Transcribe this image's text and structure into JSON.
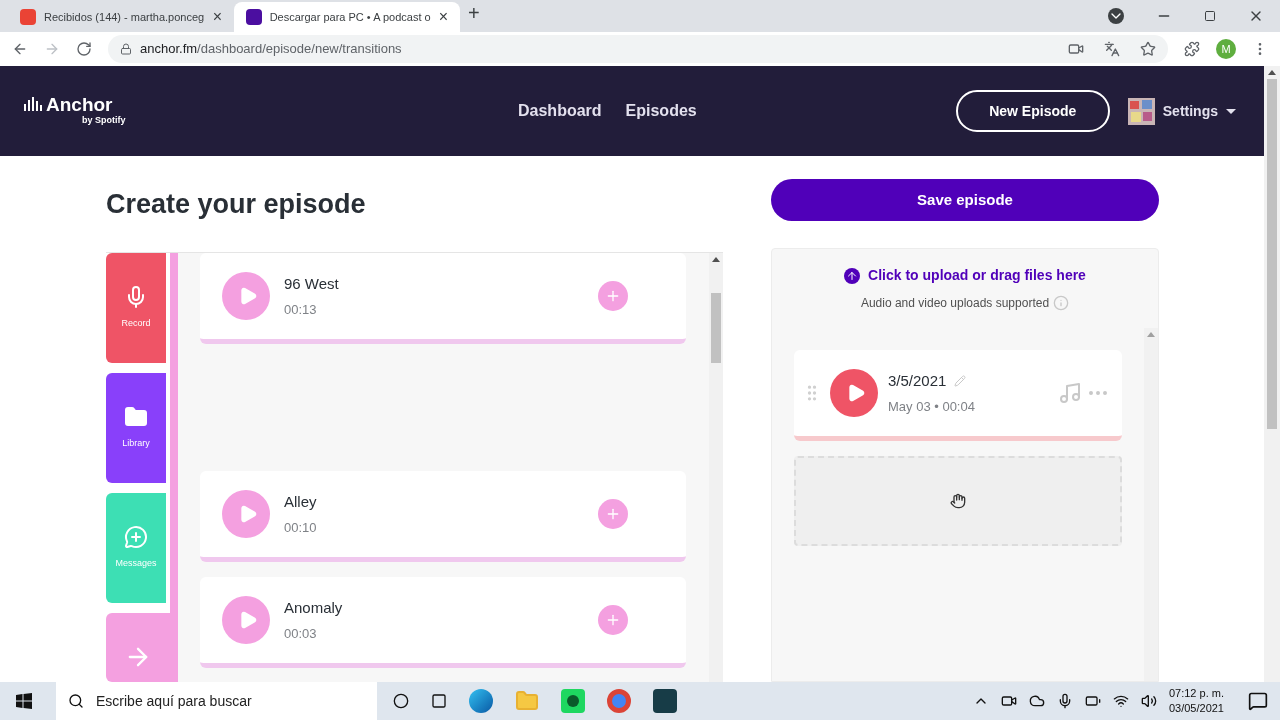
{
  "browser": {
    "tabs": [
      {
        "title": "Recibidos (144) - martha.ponceg",
        "selected": false,
        "close": "×"
      },
      {
        "title": "Descargar para PC • A podcast o",
        "selected": true,
        "close": "×"
      }
    ],
    "new_tab": "+",
    "url_host": "anchor.fm",
    "url_path": "/dashboard/episode/new/transitions",
    "profile": "M"
  },
  "header": {
    "logo": "Anchor",
    "logo_sub": "by Spotify",
    "nav": [
      {
        "label": "Dashboard"
      },
      {
        "label": "Episodes"
      }
    ],
    "new_episode": "New Episode",
    "settings": "Settings"
  },
  "page": {
    "title": "Create your episode",
    "save": "Save episode"
  },
  "tools": [
    {
      "kind": "record",
      "label": "Record",
      "color": "#ef5466",
      "selected": false
    },
    {
      "kind": "library",
      "label": "Library",
      "color": "#8940fa",
      "selected": false
    },
    {
      "kind": "messages",
      "label": "Messages",
      "color": "#3ddfb4",
      "selected": false
    },
    {
      "kind": "transitions",
      "color": "#f4a0e0",
      "selected": true
    }
  ],
  "transitions": [
    {
      "name": "96 West",
      "duration": "00:13"
    },
    {
      "name": "Alley",
      "duration": "00:10"
    },
    {
      "name": "Anomaly",
      "duration": "00:03"
    }
  ],
  "upload": {
    "link": "Click to upload or drag files here",
    "hint": "Audio and video uploads supported"
  },
  "segments": [
    {
      "title": "3/5/2021",
      "meta": "May 03 • 00:04"
    }
  ],
  "taskbar": {
    "search_placeholder": "Escribe aquí para buscar",
    "time": "07:12 p. m.",
    "date": "03/05/2021"
  }
}
